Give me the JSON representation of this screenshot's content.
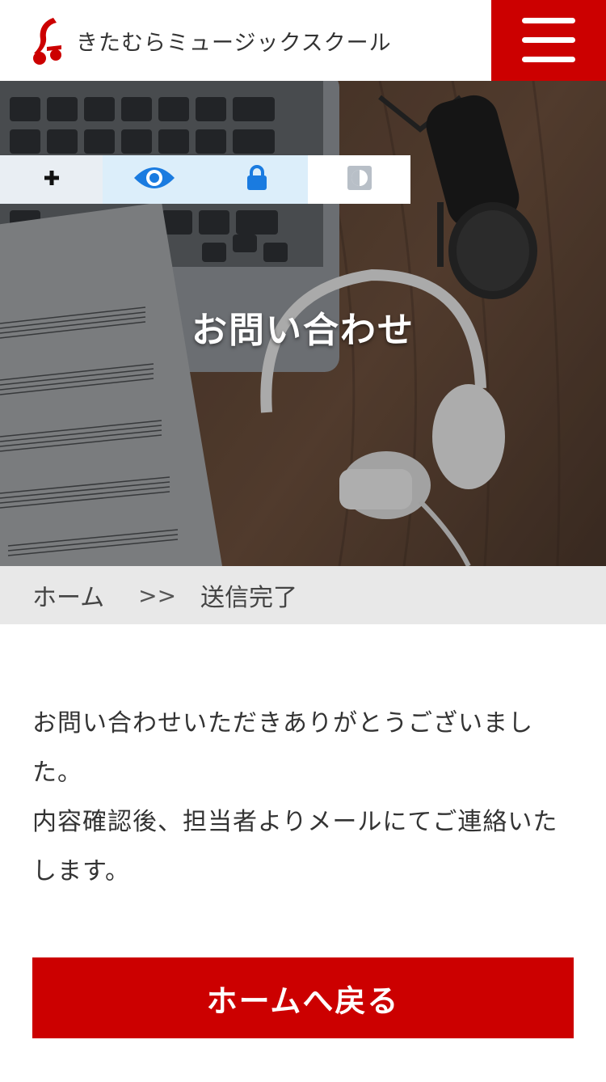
{
  "header": {
    "logo_text": "きたむらミュージックスクール",
    "brand_color": "#cc0000"
  },
  "accessibility_toolbar": {
    "items": [
      {
        "icon": "plus-icon"
      },
      {
        "icon": "eye-icon"
      },
      {
        "icon": "lock-icon"
      },
      {
        "icon": "contrast-icon"
      }
    ]
  },
  "hero": {
    "title": "お問い合わせ"
  },
  "breadcrumb": {
    "home": "ホーム",
    "separator": ">>",
    "current": "送信完了"
  },
  "message": {
    "line1": "お問い合わせいただきありがとうございました。",
    "line2": "内容確認後、担当者よりメールにてご連絡いたします。"
  },
  "actions": {
    "home_button": "ホームへ戻る"
  }
}
